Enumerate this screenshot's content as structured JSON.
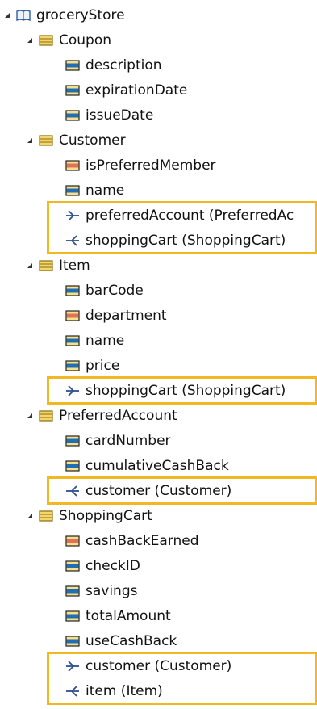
{
  "colors": {
    "highlight": "#f2b822",
    "class_icon": "#f4d66a",
    "attr_icon": "#1f6fb8",
    "enum_attr_icon": "#e0705a"
  },
  "tree": {
    "root": {
      "label": "groceryStore",
      "icon": "package-book-icon"
    },
    "classes": [
      {
        "label": "Coupon",
        "members": [
          {
            "label": "description",
            "kind": "attribute"
          },
          {
            "label": "expirationDate",
            "kind": "attribute"
          },
          {
            "label": "issueDate",
            "kind": "attribute"
          }
        ]
      },
      {
        "label": "Customer",
        "members": [
          {
            "label": "isPreferredMember",
            "kind": "enum-attribute"
          },
          {
            "label": "name",
            "kind": "attribute"
          },
          {
            "label": "preferredAccount (PreferredAc",
            "kind": "reference-out",
            "highlighted": true
          },
          {
            "label": "shoppingCart (ShoppingCart)",
            "kind": "reference-in",
            "highlighted": true
          }
        ]
      },
      {
        "label": "Item",
        "members": [
          {
            "label": "barCode",
            "kind": "attribute"
          },
          {
            "label": "department",
            "kind": "enum-attribute"
          },
          {
            "label": "name",
            "kind": "attribute"
          },
          {
            "label": "price",
            "kind": "attribute"
          },
          {
            "label": "shoppingCart (ShoppingCart)",
            "kind": "reference-out",
            "highlighted": true
          }
        ]
      },
      {
        "label": "PreferredAccount",
        "members": [
          {
            "label": "cardNumber",
            "kind": "attribute"
          },
          {
            "label": "cumulativeCashBack",
            "kind": "attribute"
          },
          {
            "label": "customer (Customer)",
            "kind": "reference-in",
            "highlighted": true
          }
        ]
      },
      {
        "label": "ShoppingCart",
        "members": [
          {
            "label": "cashBackEarned",
            "kind": "enum-attribute"
          },
          {
            "label": "checkID",
            "kind": "attribute"
          },
          {
            "label": "savings",
            "kind": "attribute"
          },
          {
            "label": "totalAmount",
            "kind": "attribute"
          },
          {
            "label": "useCashBack",
            "kind": "attribute"
          },
          {
            "label": "customer (Customer)",
            "kind": "reference-out",
            "highlighted": true
          },
          {
            "label": "item (Item)",
            "kind": "reference-in",
            "highlighted": true
          }
        ]
      }
    ]
  }
}
